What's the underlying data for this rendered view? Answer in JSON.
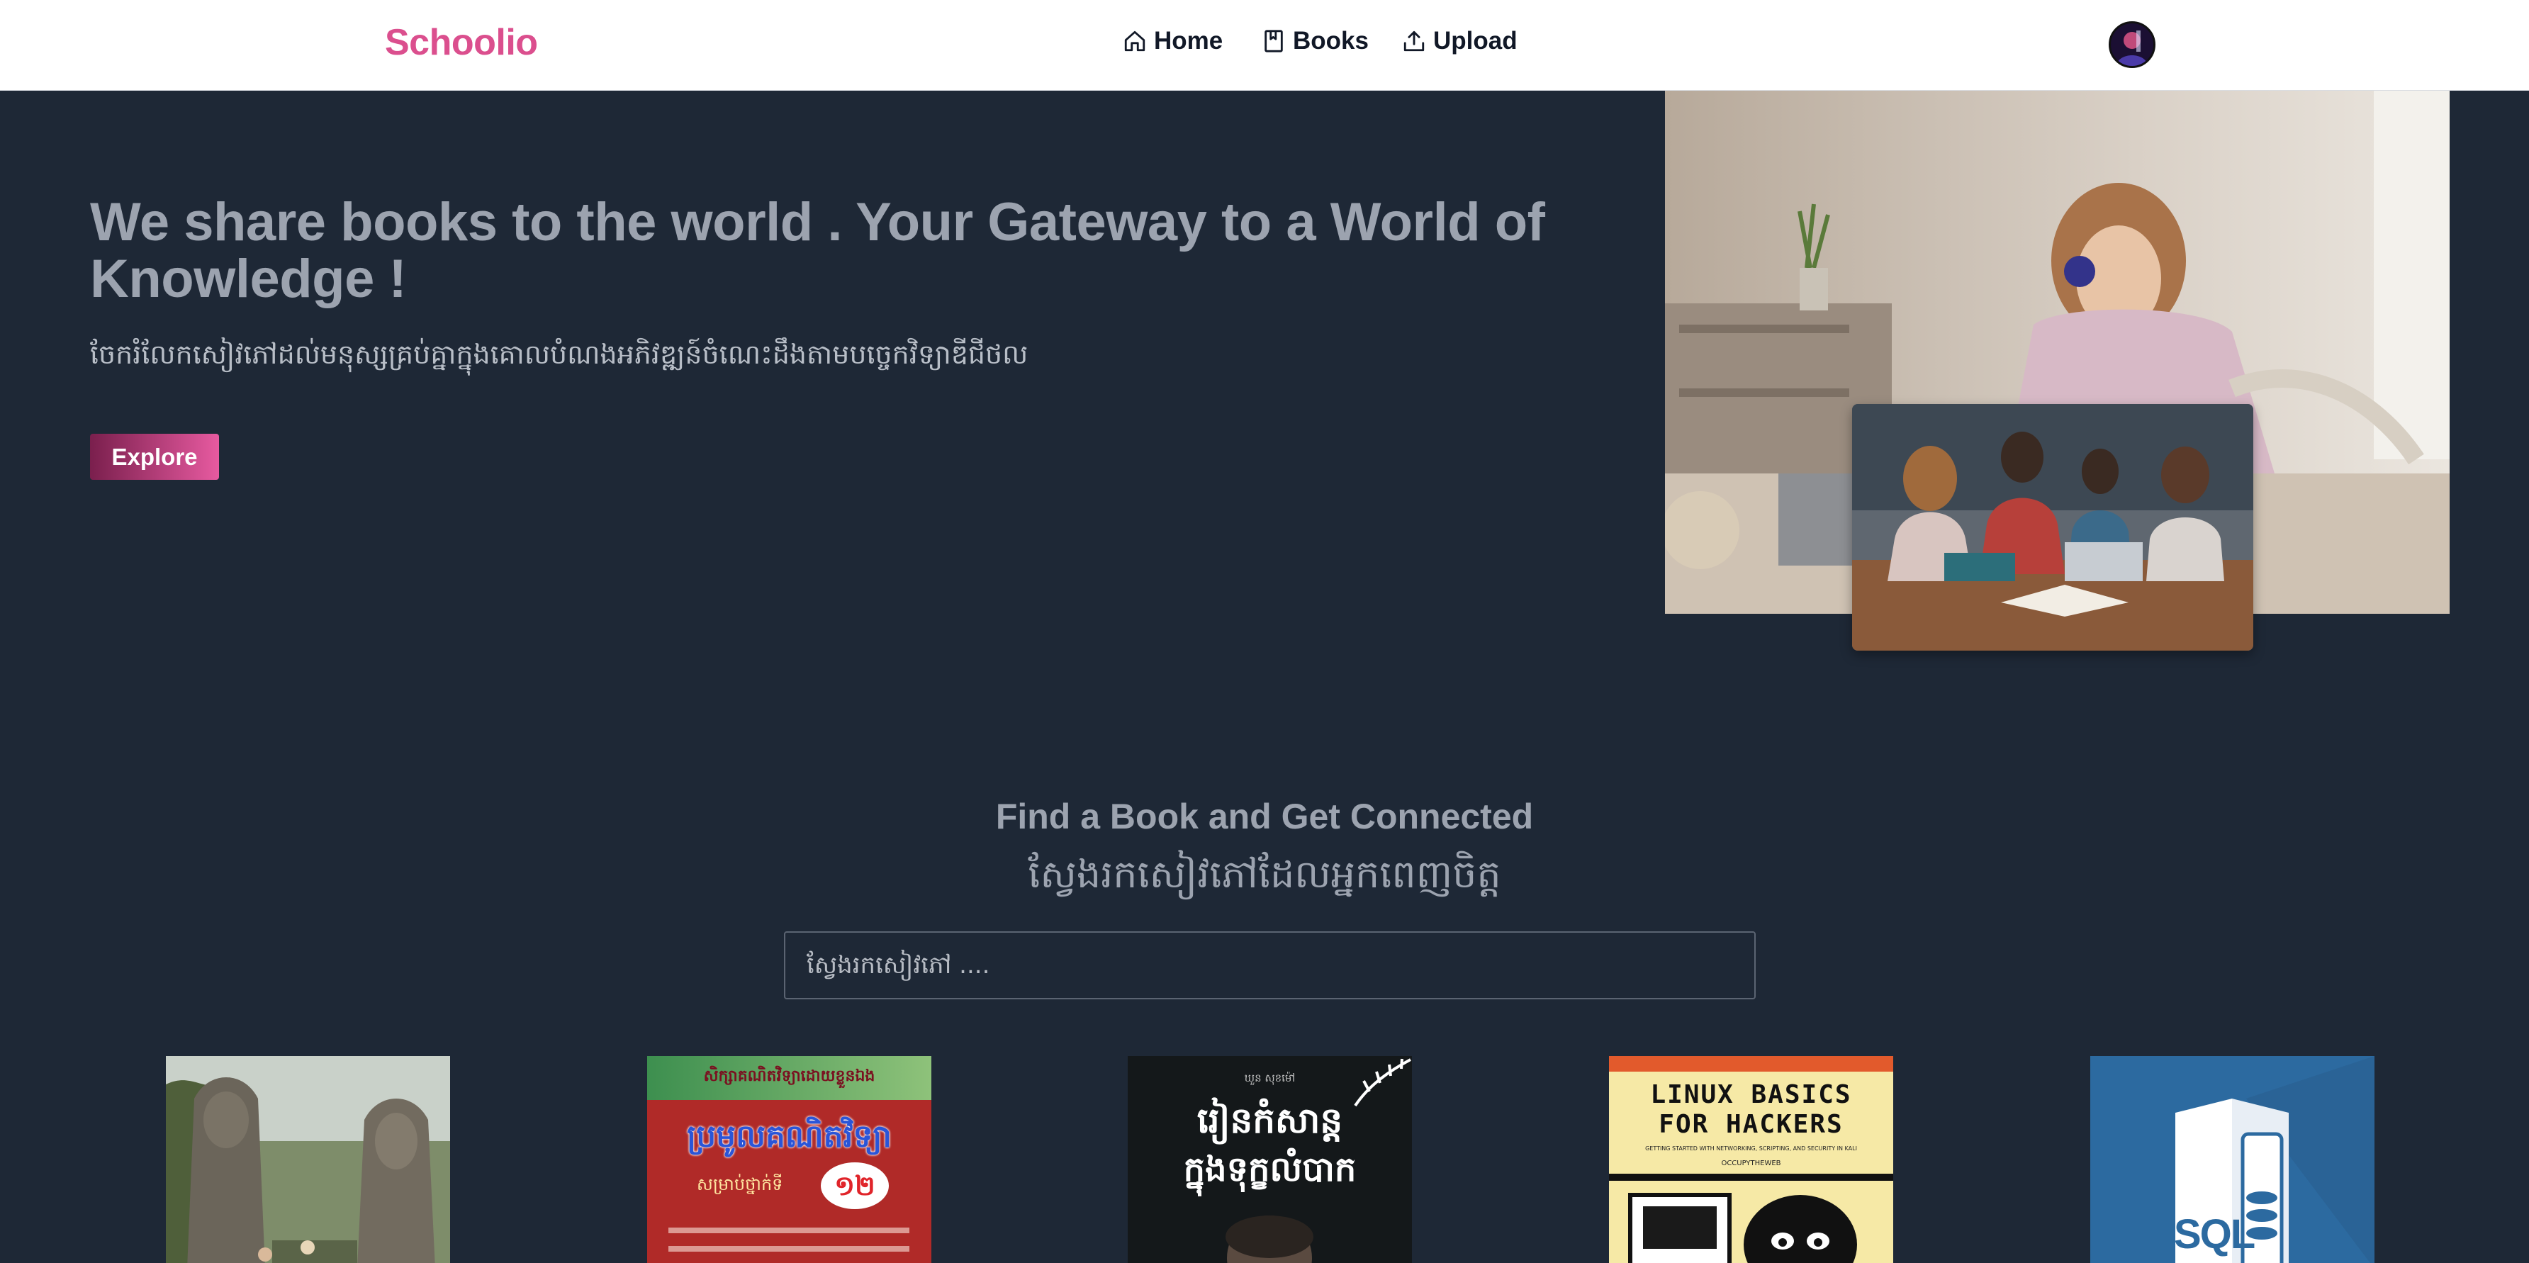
{
  "nav": {
    "brand": "Schoolio",
    "items": [
      {
        "label": "Home",
        "icon": "home-icon"
      },
      {
        "label": "Books",
        "icon": "book-icon"
      },
      {
        "label": "Upload",
        "icon": "upload-icon"
      }
    ],
    "avatar_icon": "user-avatar"
  },
  "hero": {
    "title": "We share books to the world . Your Gateway to a World of Knowledge !",
    "subtitle": "ចែករំលែកសៀវភៅដល់មនុស្សគ្រប់គ្នាក្នុងគោលបំណងអភិវឌ្ឍន៍ចំណេះដឹងតាមបច្ចេកវិទ្យាឌីជីថល",
    "explore_label": "Explore"
  },
  "search": {
    "title": "Find a Book and Get Connected",
    "subtitle": "ស្វែងរកសៀវភៅដែលអ្នកពេញចិត្ត",
    "placeholder": "ស្វែងរកសៀវភៅ ...."
  },
  "books": [
    {
      "cover_text": []
    },
    {
      "cover_text": [
        "សិក្សាគណិតវិទ្យាដោយខ្លួនឯង",
        "ប្រមូលគណិតវិទ្យា",
        "សម្រាប់ថ្នាក់ទី",
        "១២"
      ]
    },
    {
      "cover_text": [
        "ឃួន សុខម៉ៅ",
        "រៀនកំសាន្ត",
        "ក្នុងទុក្ខលំបាក"
      ]
    },
    {
      "cover_text": [
        "LINUX BASICS",
        "FOR HACKERS",
        "GETTING STARTED WITH NETWORKING, SCRIPTING, AND SECURITY IN KALI",
        "OCCUPYTHEWEB"
      ]
    },
    {
      "cover_text": [
        "SQL"
      ]
    }
  ],
  "colors": {
    "brand": "#db4f8e",
    "page_bg": "#1e2836",
    "heading_text": "#9ca3af",
    "button_gradient_start": "#7a1f4d",
    "button_gradient_end": "#e75aa0"
  }
}
